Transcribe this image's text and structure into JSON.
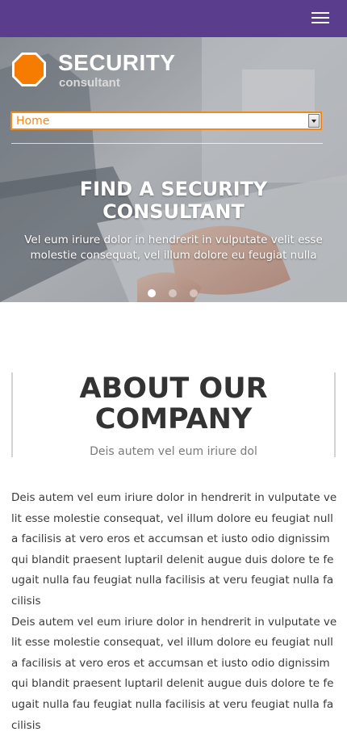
{
  "header": {
    "menu_icon": "hamburger-menu-icon",
    "bar_color": "#5a3d8c"
  },
  "brand": {
    "title": "SECURITY",
    "subtitle": "consultant",
    "logo_icon": "octagon-logo-icon",
    "logo_color": "#f57c00"
  },
  "nav": {
    "selected": "Home",
    "accent": "#f08a1c"
  },
  "hero": {
    "title": "FIND A SECURITY CONSULTANT",
    "text": "Vel eum iriure dolor in hendrerit in vulputate velit esse molestie consequat, vel illum dolore eu feugiat nulla",
    "slides": 3,
    "active_slide": 1
  },
  "about": {
    "title": "ABOUT OUR COMPANY",
    "subtitle": "Deis autem vel eum iriure dol",
    "body": "Deis autem vel eum iriure dolor in hendrerit in vulputate velit esse molestie consequat, vel illum dolore eu feugiat nulla facilisis at vero eros et accumsan et iusto odio dignissim qui blandit praesent luptaril delenit augue duis dolore te feugait nulla fau feugiat nulla facilisis at veru feugiat nulla facilisis\nDeis autem vel eum iriure dolor in hendrerit in vulputate velit esse molestie consequat, vel illum dolore eu feugiat nulla facilisis at vero eros et accumsan et iusto odio dignissim qui blandit praesent luptaril delenit augue duis dolore te feugait nulla fau feugiat nulla facilisis at veru feugiat nulla facilisis"
  }
}
